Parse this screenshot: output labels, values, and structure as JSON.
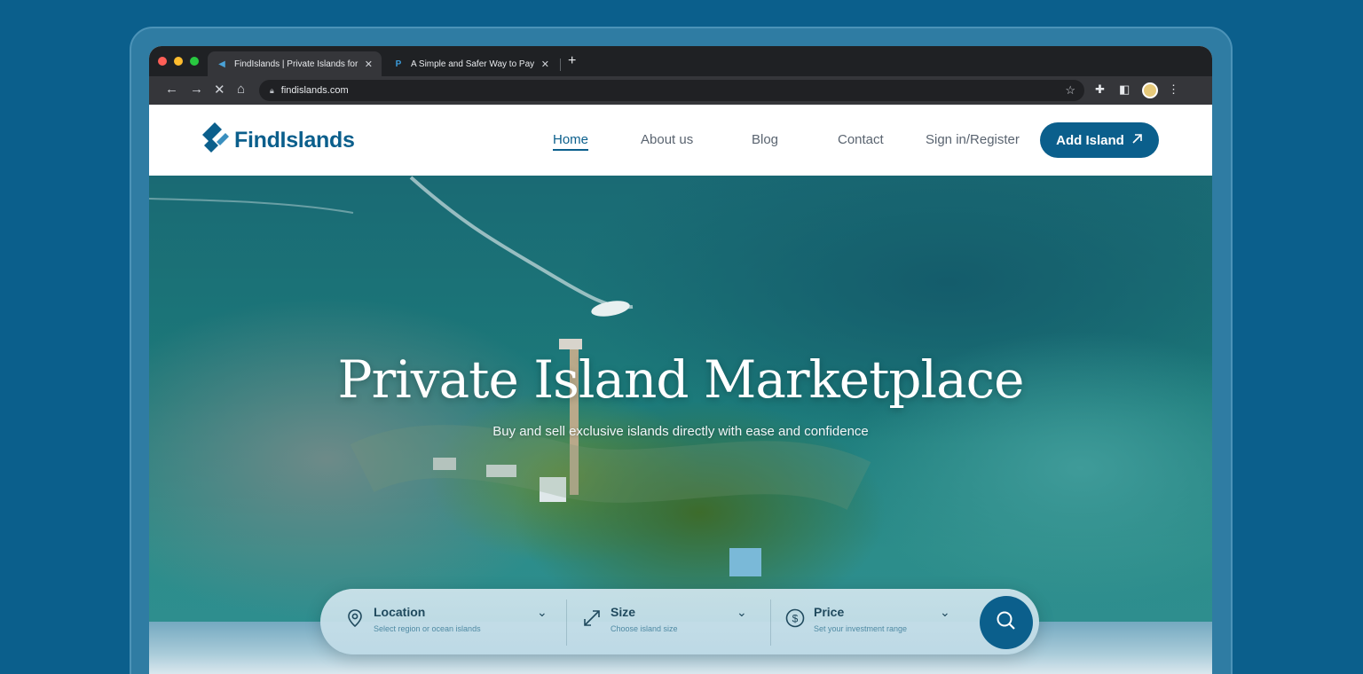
{
  "browser": {
    "tabs": [
      {
        "title": "FindIslands | Private Islands for Sale",
        "active": true
      },
      {
        "title": "A Simple and Safer Way to Pay",
        "active": false
      }
    ],
    "url": "findislands.com"
  },
  "header": {
    "logo_text": "FindIslands",
    "nav": [
      "Home",
      "About us",
      "Blog",
      "Contact"
    ],
    "sign_in": "Sign in/Register",
    "cta": "Add Island"
  },
  "hero": {
    "title": "Private Island Marketplace",
    "subtitle": "Buy and sell exclusive islands directly with ease and confidence"
  },
  "search": {
    "fields": [
      {
        "label": "Location",
        "hint": "Select region or ocean islands"
      },
      {
        "label": "Size",
        "hint": "Choose island size"
      },
      {
        "label": "Price",
        "hint": "Set your investment range"
      }
    ]
  },
  "colors": {
    "brand": "#0b5f8c",
    "background": "#0b5f8c"
  }
}
